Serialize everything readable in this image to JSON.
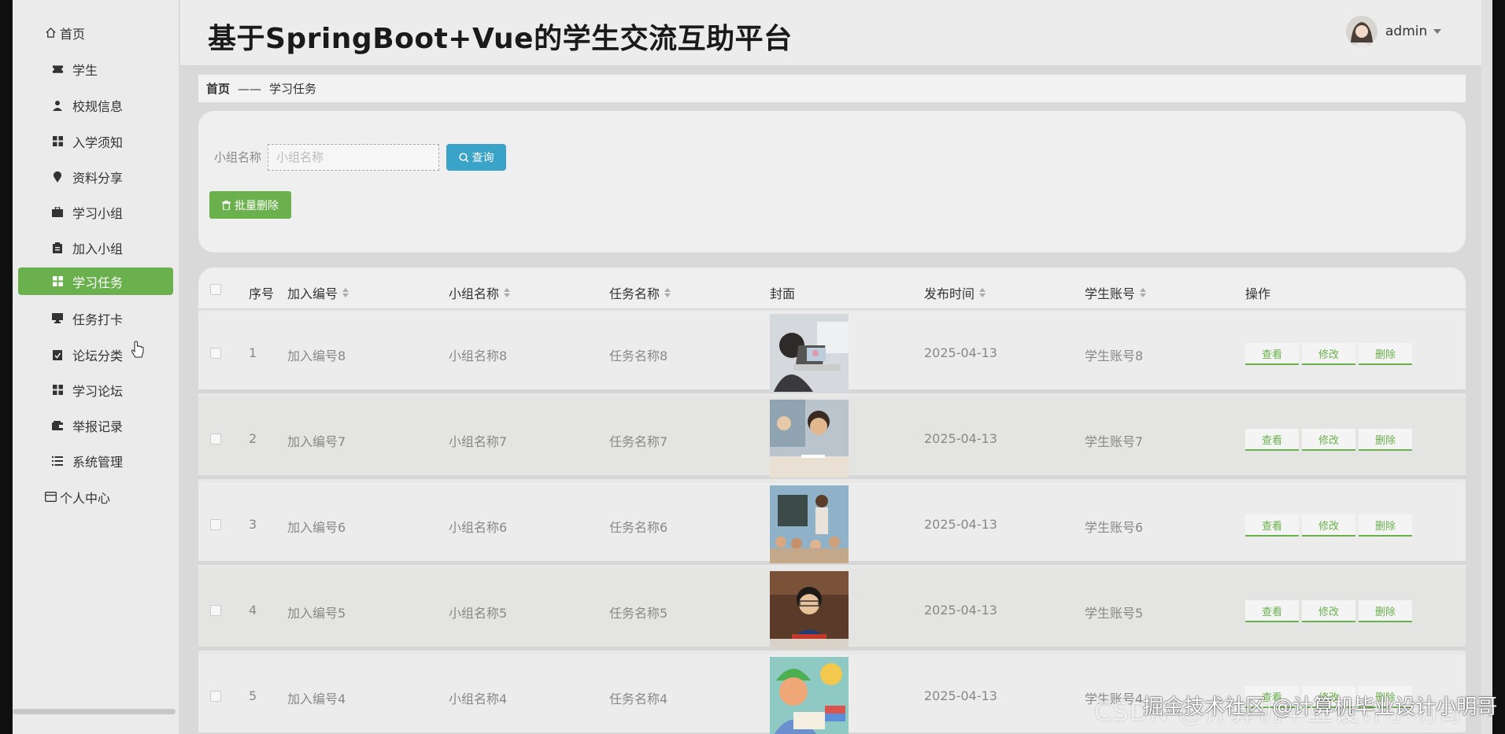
{
  "app": {
    "title": "基于SpringBoot+Vue的学生交流互助平台"
  },
  "user": {
    "name": "admin"
  },
  "sidebar": {
    "items": [
      {
        "label": "首页",
        "icon": "home-icon"
      },
      {
        "label": "学生",
        "icon": "ticket-icon"
      },
      {
        "label": "校规信息",
        "icon": "user-icon"
      },
      {
        "label": "入学须知",
        "icon": "grid-icon"
      },
      {
        "label": "资料分享",
        "icon": "location-pin-icon"
      },
      {
        "label": "学习小组",
        "icon": "briefcase-icon"
      },
      {
        "label": "加入小组",
        "icon": "clipboard-icon"
      },
      {
        "label": "学习任务",
        "icon": "grid-icon",
        "active": true
      },
      {
        "label": "任务打卡",
        "icon": "monitor-icon"
      },
      {
        "label": "论坛分类",
        "icon": "checklist-icon"
      },
      {
        "label": "学习论坛",
        "icon": "grid-icon"
      },
      {
        "label": "举报记录",
        "icon": "wallet-icon"
      },
      {
        "label": "系统管理",
        "icon": "list-icon"
      },
      {
        "label": "个人中心",
        "icon": "card-icon"
      }
    ]
  },
  "breadcrumb": {
    "home": "首页",
    "separator": "——",
    "current": "学习任务"
  },
  "search": {
    "label": "小组名称",
    "placeholder": "小组名称",
    "button": "查询"
  },
  "actions": {
    "batch_delete": "批量删除"
  },
  "table": {
    "columns": [
      "序号",
      "加入编号",
      "小组名称",
      "任务名称",
      "封面",
      "发布时间",
      "学生账号",
      "操作"
    ],
    "rows": [
      {
        "index": "1",
        "join_no": "加入编号8",
        "group": "小组名称8",
        "task": "任务名称8",
        "time": "2025-04-13",
        "account": "学生账号8"
      },
      {
        "index": "2",
        "join_no": "加入编号7",
        "group": "小组名称7",
        "task": "任务名称7",
        "time": "2025-04-13",
        "account": "学生账号7"
      },
      {
        "index": "3",
        "join_no": "加入编号6",
        "group": "小组名称6",
        "task": "任务名称6",
        "time": "2025-04-13",
        "account": "学生账号6"
      },
      {
        "index": "4",
        "join_no": "加入编号5",
        "group": "小组名称5",
        "task": "任务名称5",
        "time": "2025-04-13",
        "account": "学生账号5"
      },
      {
        "index": "5",
        "join_no": "加入编号4",
        "group": "小组名称4",
        "task": "任务名称4",
        "time": "2025-04-13",
        "account": "学生账号4"
      }
    ],
    "op_labels": {
      "view": "查看",
      "edit": "修改",
      "delete": "删除"
    }
  },
  "watermark": {
    "csdn": "CSDN @计算机毕业设计小明哥",
    "juejin": "掘金技术社区 @计算机毕业设计小明哥"
  },
  "colors": {
    "accent_green": "#6ab04c",
    "search_blue": "#3aa3c7"
  }
}
